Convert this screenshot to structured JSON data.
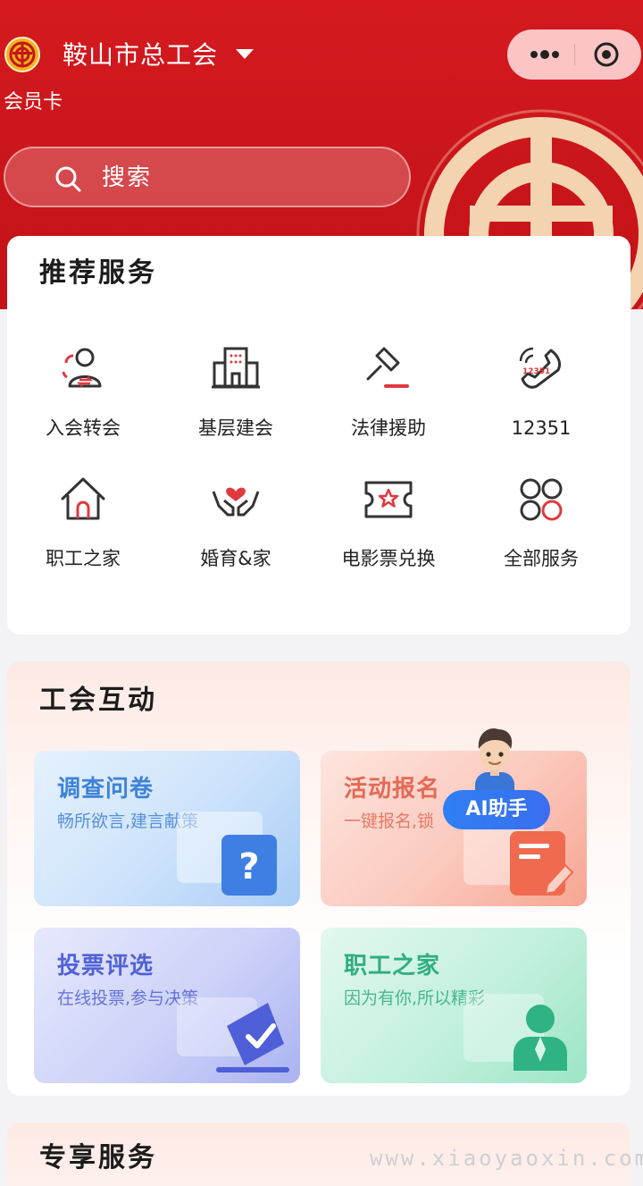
{
  "header": {
    "app_title": "鞍山市总工会",
    "subtitle": "会员卡",
    "search_placeholder": "搜索",
    "primary_color": "#d41a1f"
  },
  "recommended": {
    "title": "推荐服务",
    "items": [
      {
        "label": "入会转会",
        "icon": "member-transfer-icon"
      },
      {
        "label": "基层建会",
        "icon": "building-icon"
      },
      {
        "label": "法律援助",
        "icon": "gavel-icon"
      },
      {
        "label": "12351",
        "icon": "hotline-phone-icon"
      },
      {
        "label": "职工之家",
        "icon": "home-icon"
      },
      {
        "label": "婚育&家",
        "icon": "heart-hands-icon"
      },
      {
        "label": "电影票兑换",
        "icon": "ticket-icon"
      },
      {
        "label": "全部服务",
        "icon": "all-services-icon"
      }
    ],
    "hotline_number_on_icon": "12351"
  },
  "interaction": {
    "title": "工会互动",
    "tiles": [
      {
        "title": "调查问卷",
        "subtitle": "畅所欲言,建言献策",
        "color": "#3f82d8"
      },
      {
        "title": "活动报名",
        "subtitle": "一键报名,锁",
        "color": "#e46a55"
      },
      {
        "title": "投票评选",
        "subtitle": "在线投票,参与决策",
        "color": "#5162d6"
      },
      {
        "title": "职工之家",
        "subtitle": "因为有你,所以精彩",
        "color": "#2fae7e"
      }
    ],
    "ai_assistant_label": "AI助手"
  },
  "exclusive": {
    "title": "专享服务"
  },
  "watermark": "www.xiaoyaoxin.com"
}
